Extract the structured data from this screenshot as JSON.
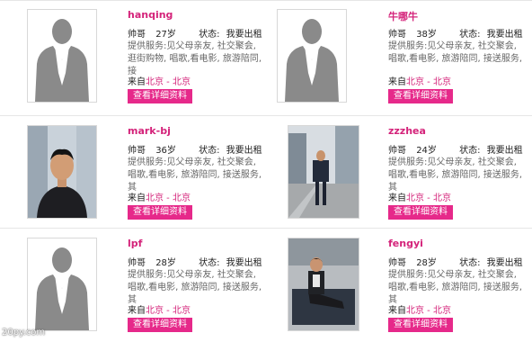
{
  "labels": {
    "status_label": "状态:",
    "services_prefix": "提供服务:",
    "location_prefix": "来自",
    "button_label": "查看详细资料"
  },
  "profiles": [
    {
      "name": "hanqing",
      "role": "帅哥",
      "age": "27岁",
      "status": "我要出租",
      "services": "见父母亲友, 社交聚会, 逛街购物, 唱歌,看电影, 旅游陪同, 接",
      "location": "北京 - 北京",
      "photo": "silhouette"
    },
    {
      "name": "牛哪牛",
      "role": "帅哥",
      "age": "38岁",
      "status": "我要出租",
      "services": "见父母亲友, 社交聚会, 唱歌,看电影, 旅游陪同, 接送服务,",
      "location": "北京 - 北京",
      "photo": "silhouette"
    },
    {
      "name": "mark-bj",
      "role": "帅哥",
      "age": "36岁",
      "status": "我要出租",
      "services": "见父母亲友, 社交聚会, 唱歌,看电影, 旅游陪同, 接送服务, 其",
      "location": "北京 - 北京",
      "photo": "man-portrait"
    },
    {
      "name": "zzzhea",
      "role": "帅哥",
      "age": "24岁",
      "status": "我要出租",
      "services": "见父母亲友, 社交聚会, 唱歌,看电影, 旅游陪同, 接送服务, 其",
      "location": "北京 - 北京",
      "photo": "man-street"
    },
    {
      "name": "lpf",
      "role": "帅哥",
      "age": "28岁",
      "status": "我要出租",
      "services": "见父母亲友, 社交聚会, 唱歌,看电影, 旅游陪同, 接送服务, 其",
      "location": "北京 - 北京",
      "photo": "silhouette"
    },
    {
      "name": "fengyi",
      "role": "帅哥",
      "age": "28岁",
      "status": "我要出租",
      "services": "见父母亲友, 社交聚会, 唱歌,看电影, 旅游陪同, 接送服务, 其",
      "location": "北京 - 北京",
      "photo": "man-sofa"
    }
  ],
  "watermark": "20py.com",
  "colors": {
    "accent": "#e6298a",
    "name": "#d4237a",
    "silhouette": "#8a8a8a"
  }
}
